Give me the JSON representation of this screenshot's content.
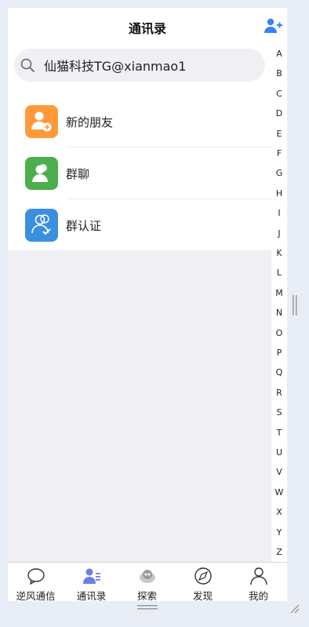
{
  "header": {
    "title": "通讯录"
  },
  "search": {
    "value": "仙猫科技TG@xianmao1",
    "placeholder": ""
  },
  "entries": [
    {
      "label": "新的朋友",
      "color": "#ff9a3c"
    },
    {
      "label": "群聊",
      "color": "#4cae4c"
    },
    {
      "label": "群认证",
      "color": "#3b8fe0"
    }
  ],
  "index_letters": [
    "A",
    "B",
    "C",
    "D",
    "E",
    "F",
    "G",
    "H",
    "I",
    "J",
    "K",
    "L",
    "M",
    "N",
    "O",
    "P",
    "Q",
    "R",
    "S",
    "T",
    "U",
    "V",
    "W",
    "X",
    "Y",
    "Z"
  ],
  "tabs": [
    {
      "label": "逆风通信",
      "icon": "chat-icon"
    },
    {
      "label": "通讯录",
      "icon": "contacts-icon",
      "active": true
    },
    {
      "label": "探索",
      "icon": "explore-icon"
    },
    {
      "label": "发现",
      "icon": "compass-icon"
    },
    {
      "label": "我的",
      "icon": "profile-icon"
    }
  ],
  "colors": {
    "accent": "#3b82f6",
    "active_tab": "#6e7fe6",
    "background": "#efeff4"
  }
}
